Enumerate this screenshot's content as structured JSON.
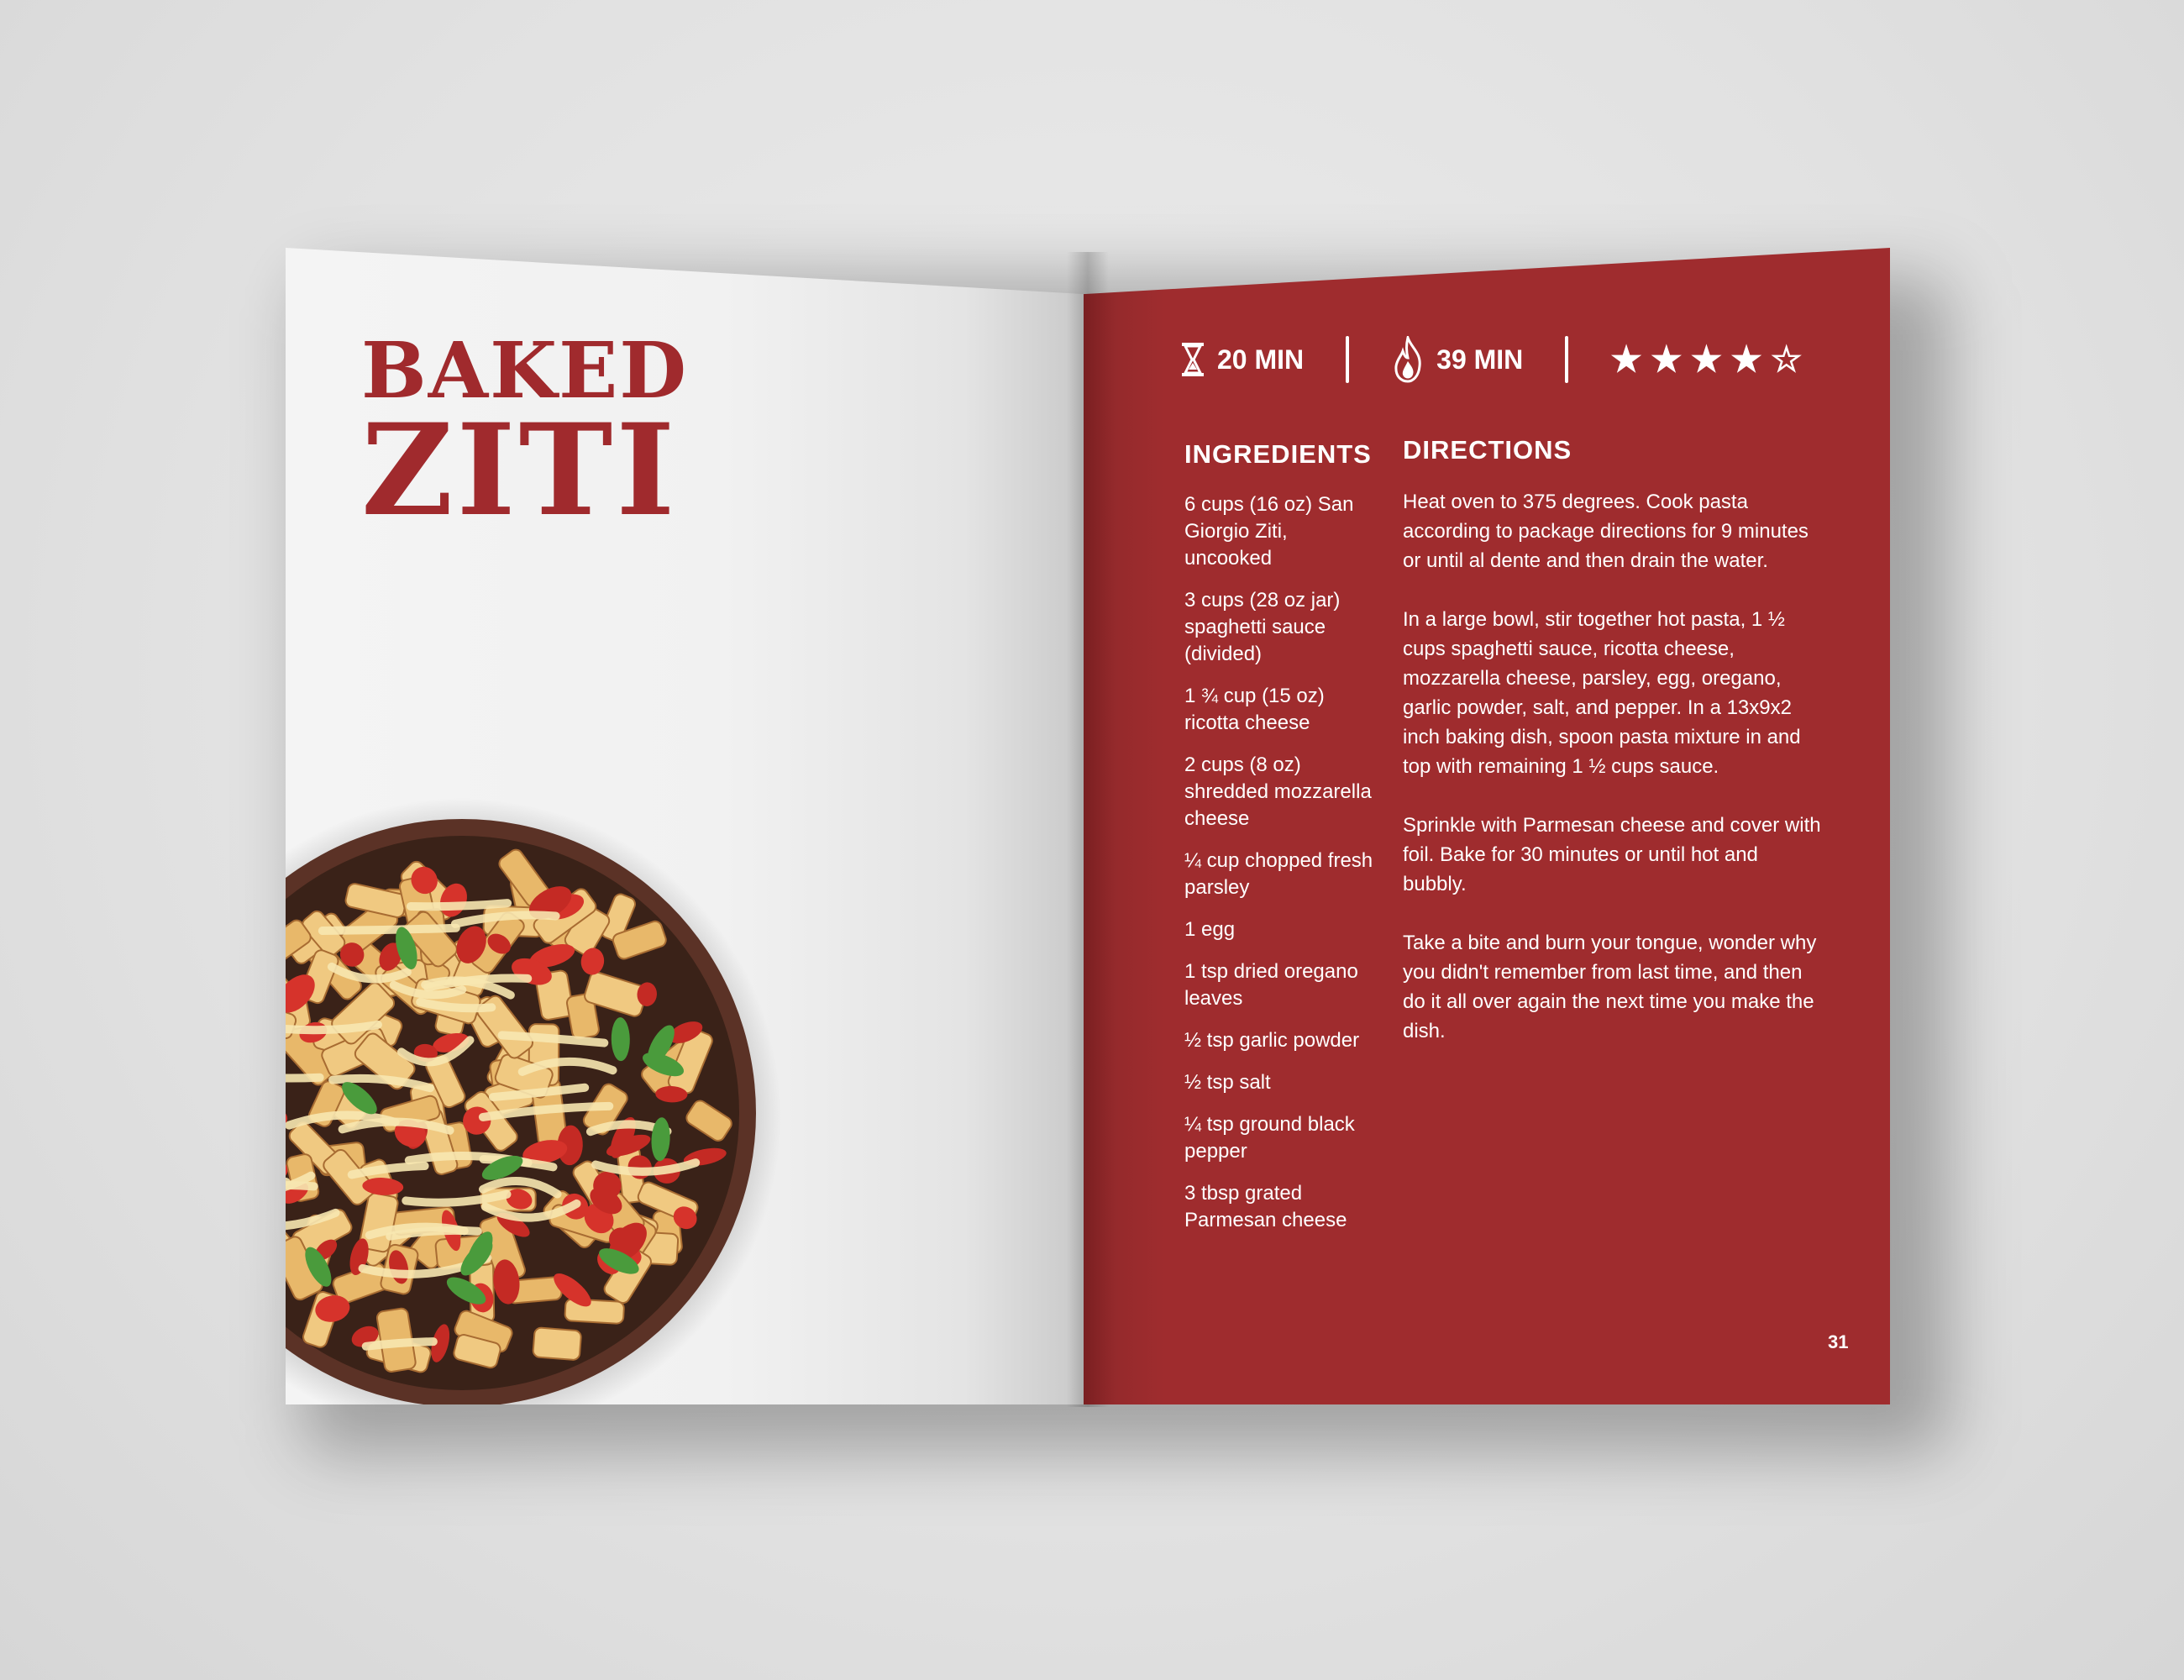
{
  "title": {
    "line1": "BAKED",
    "line2": "ZITI"
  },
  "stats": {
    "prep_time": "20 MIN",
    "cook_time": "39 MIN",
    "rating_stars": [
      "★",
      "★",
      "★",
      "★",
      "☆"
    ],
    "prep_icon": "hourglass-icon",
    "cook_icon": "flame-icon"
  },
  "ingredients": {
    "heading": "INGREDIENTS",
    "items": [
      "6 cups (16 oz) San Giorgio Ziti, uncooked",
      "3 cups (28 oz jar) spaghetti sauce (divided)",
      "1 ¾ cup (15 oz) ricotta cheese",
      "2 cups (8 oz) shredded mozzarella cheese",
      "¼ cup chopped fresh parsley",
      "1 egg",
      "1 tsp dried oregano leaves",
      "½ tsp garlic powder",
      "½ tsp salt",
      "¼ tsp ground black pepper",
      "3 tbsp grated Parmesan cheese"
    ]
  },
  "directions": {
    "heading": "DIRECTIONS",
    "paragraphs": [
      "Heat oven to 375 degrees. Cook pasta according to package directions for 9 minutes or until al dente and then drain the water.",
      "In a large bowl, stir together hot pasta, 1 ½ cups spaghetti sauce, ricotta cheese, mozzarella cheese, parsley, egg, oregano, garlic powder, salt, and pepper. In a 13x9x2 inch baking dish, spoon pasta mixture in and top with remaining 1 ½ cups sauce.",
      "Sprinkle with Parmesan cheese and cover with foil. Bake for 30 minutes or until hot and bubbly.",
      "Take a bite and burn your tongue, wonder why you didn't remember from last time, and then do it all over again the next time you make the dish."
    ]
  },
  "page_number": "31",
  "colors": {
    "accent": "#9f2c2e",
    "page": "#f1f1f1",
    "text_light": "#ffffff"
  }
}
